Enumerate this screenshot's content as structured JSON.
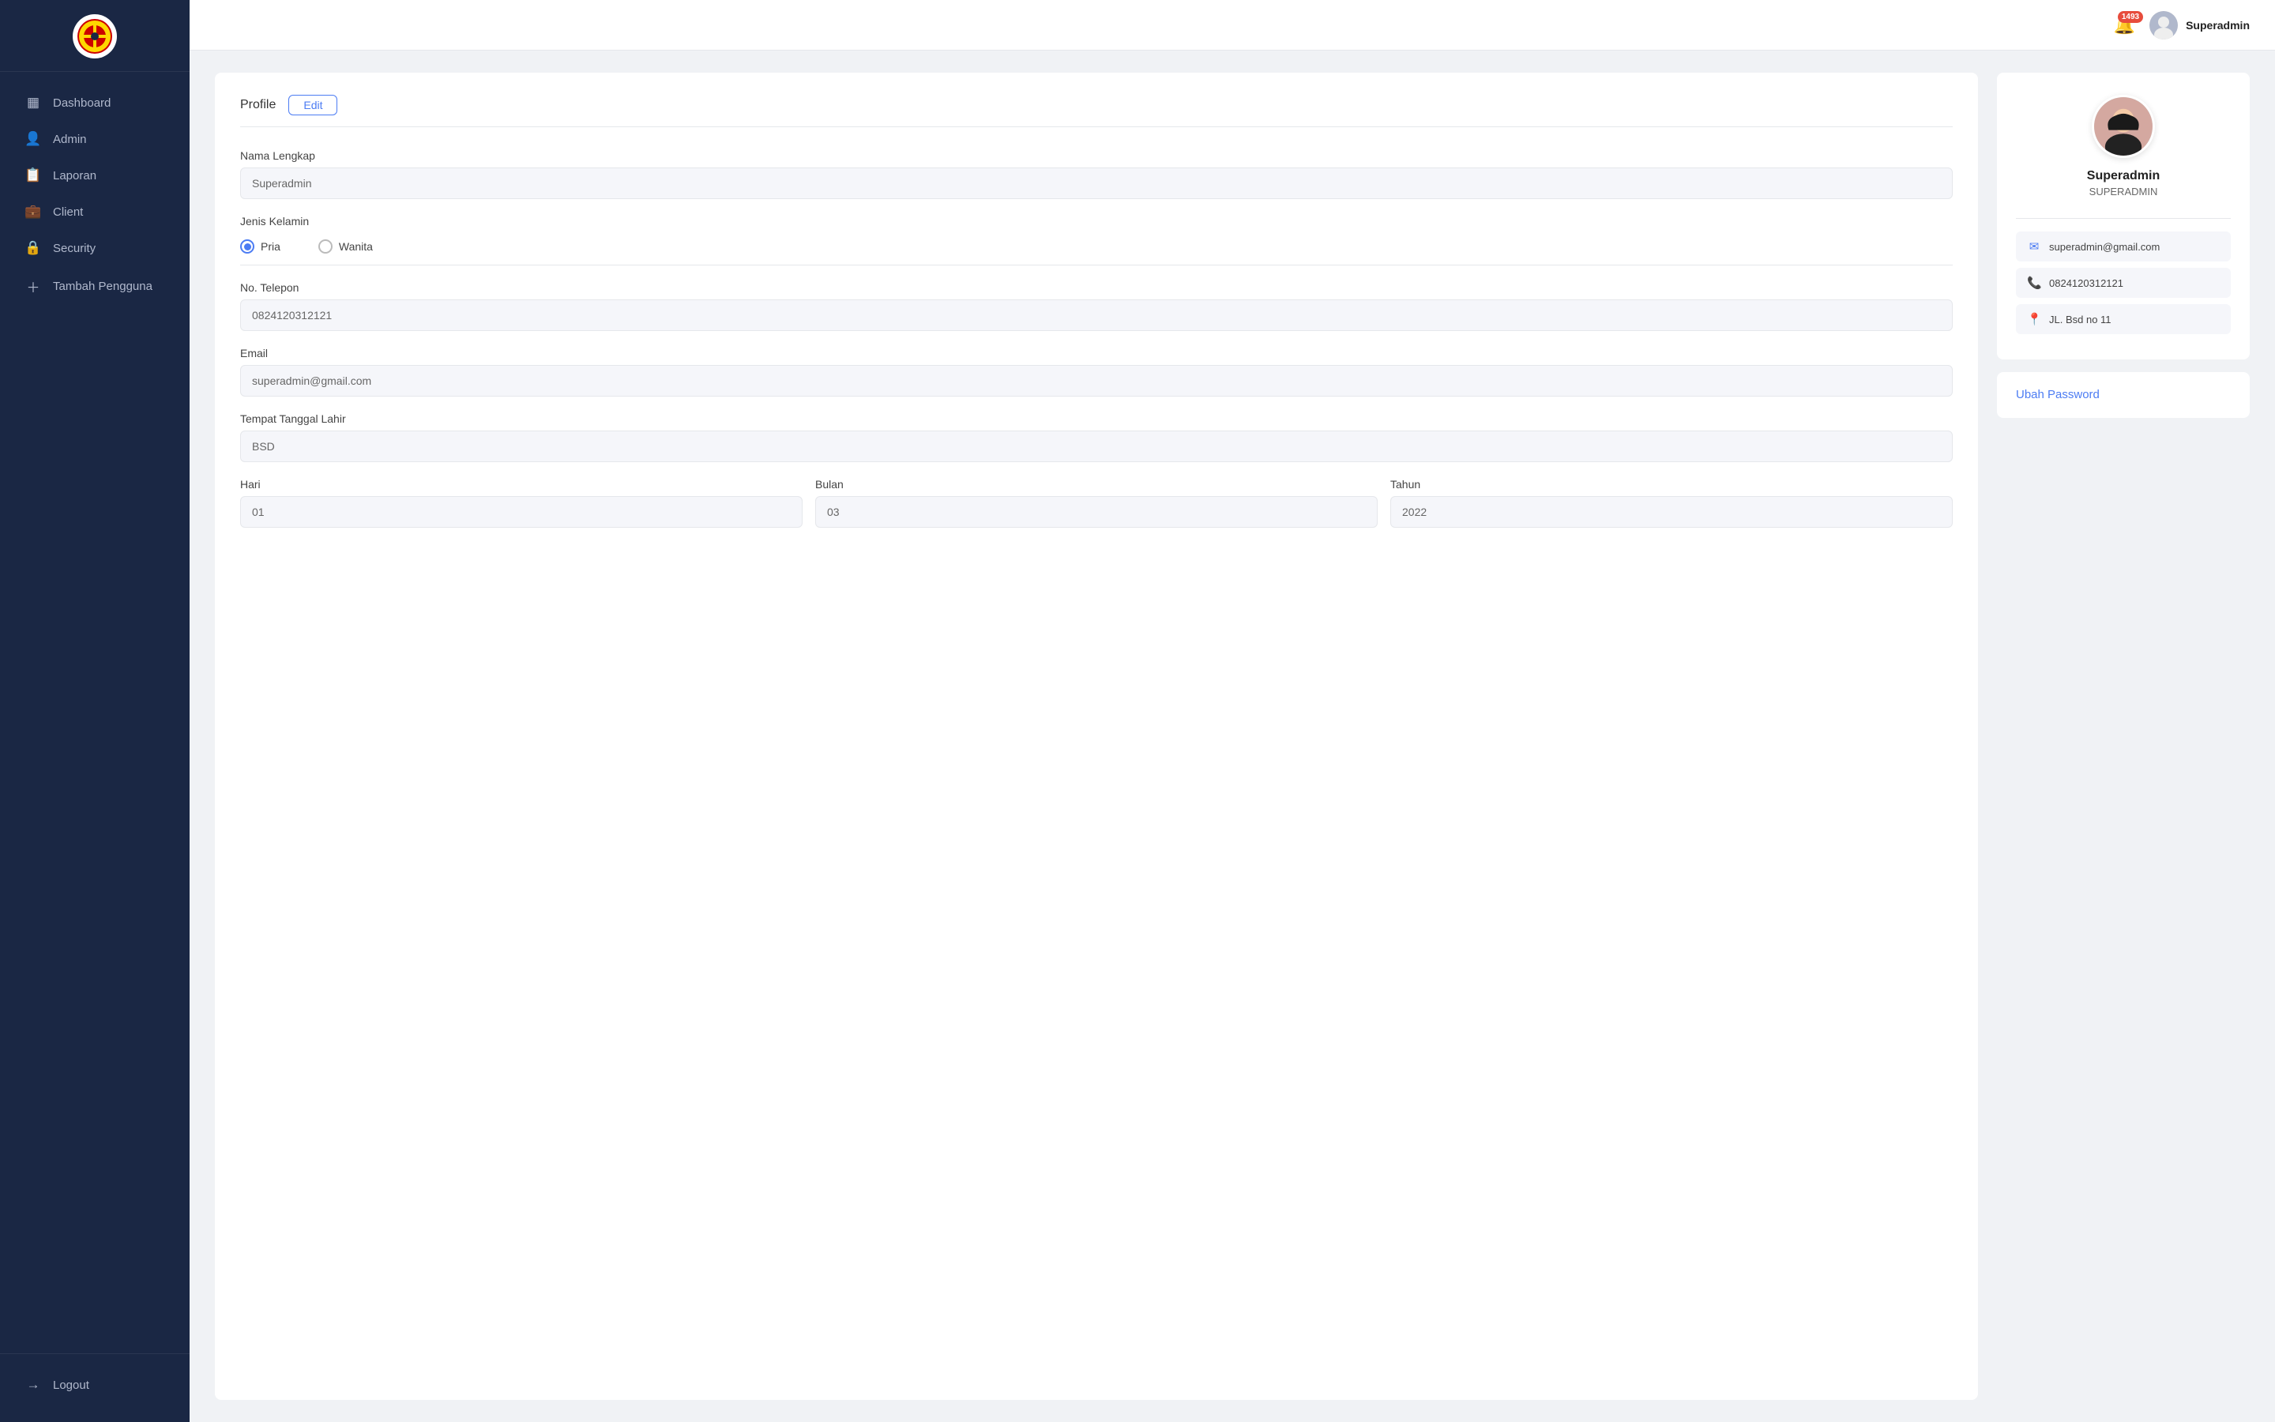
{
  "sidebar": {
    "items": [
      {
        "id": "dashboard",
        "label": "Dashboard",
        "icon": "▦",
        "active": false
      },
      {
        "id": "admin",
        "label": "Admin",
        "icon": "👤",
        "active": false
      },
      {
        "id": "laporan",
        "label": "Laporan",
        "icon": "📋",
        "active": false
      },
      {
        "id": "client",
        "label": "Client",
        "icon": "💼",
        "active": false
      },
      {
        "id": "security",
        "label": "Security",
        "icon": "🔒",
        "active": false
      },
      {
        "id": "tambah-pengguna",
        "label": "Tambah Pengguna",
        "icon": "+",
        "active": false
      }
    ],
    "logout": {
      "label": "Logout",
      "icon": "→"
    }
  },
  "topbar": {
    "notification_count": "1493",
    "username": "Superadmin"
  },
  "profile_tab": {
    "tab_label": "Profile",
    "edit_label": "Edit"
  },
  "form": {
    "nama_lengkap_label": "Nama Lengkap",
    "nama_lengkap_value": "Superadmin",
    "jenis_kelamin_label": "Jenis Kelamin",
    "pria_label": "Pria",
    "wanita_label": "Wanita",
    "gender_selected": "pria",
    "no_telepon_label": "No. Telepon",
    "no_telepon_value": "0824120312121",
    "email_label": "Email",
    "email_value": "superadmin@gmail.com",
    "tempat_tanggal_lahir_label": "Tempat Tanggal Lahir",
    "tempat_lahir_value": "BSD",
    "hari_label": "Hari",
    "hari_value": "01",
    "bulan_label": "Bulan",
    "bulan_value": "03",
    "tahun_label": "Tahun",
    "tahun_value": "2022"
  },
  "profile_card": {
    "name": "Superadmin",
    "role": "SUPERADMIN",
    "email": "superadmin@gmail.com",
    "phone": "0824120312121",
    "address": "JL. Bsd no 11",
    "ubah_password_label": "Ubah Password"
  }
}
